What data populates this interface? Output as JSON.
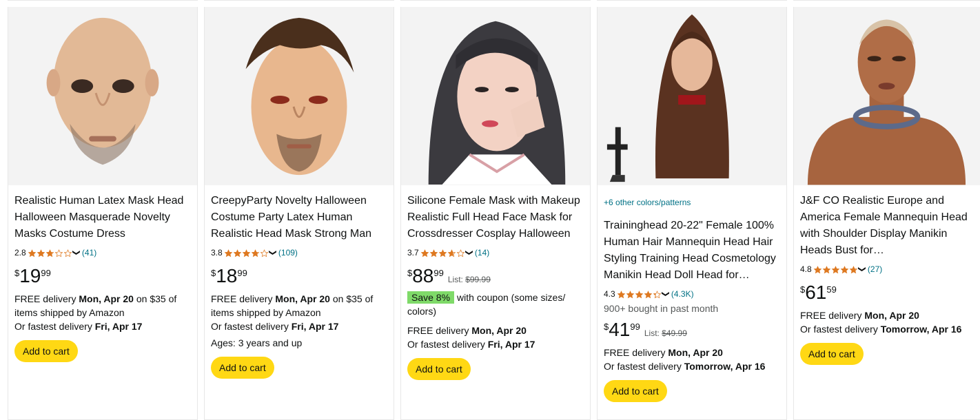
{
  "products": [
    {
      "title_lines": [
        "Realistic Human Latex Mask Head",
        "Halloween Masquerade Novelty",
        "Masks Costume Dress"
      ],
      "rating": "2.8",
      "stars_filled": 2.8,
      "reviews": "(41)",
      "price_symbol": "$",
      "price_whole": "19",
      "price_fraction": "99",
      "delivery_1_pre": "FREE delivery ",
      "delivery_1_date": "Mon, Apr 20",
      "delivery_1_post": " on $35 of",
      "delivery_2": "items shipped by Amazon",
      "fastest_pre": "Or fastest delivery ",
      "fastest_date": "Fri, Apr 17",
      "button": "Add to cart"
    },
    {
      "title_lines": [
        "CreepyParty Novelty Halloween",
        "Costume Party Latex Human",
        "Realistic Head Mask Strong Man"
      ],
      "rating": "3.8",
      "stars_filled": 3.8,
      "reviews": "(109)",
      "price_symbol": "$",
      "price_whole": "18",
      "price_fraction": "99",
      "delivery_1_pre": "FREE delivery ",
      "delivery_1_date": "Mon, Apr 20",
      "delivery_1_post": " on $35 of",
      "delivery_2": "items shipped by Amazon",
      "fastest_pre": "Or fastest delivery ",
      "fastest_date": "Fri, Apr 17",
      "ages": "Ages: 3 years and up",
      "button": "Add to cart"
    },
    {
      "title_lines": [
        "Silicone Female Mask with Makeup",
        "Realistic Full Head Face Mask for",
        "Crossdresser Cosplay Halloween"
      ],
      "rating": "3.7",
      "stars_filled": 3.7,
      "reviews": "(14)",
      "price_symbol": "$",
      "price_whole": "88",
      "price_fraction": "99",
      "list_label": "List: ",
      "list_price": "$99.99",
      "coupon_badge": "Save 8%",
      "coupon_text": "with coupon (some sizes/",
      "coupon_text_2": "colors)",
      "delivery_1_pre": "FREE delivery ",
      "delivery_1_date": "Mon, Apr 20",
      "fastest_pre": "Or fastest delivery ",
      "fastest_date": "Fri, Apr 17",
      "button": "Add to cart"
    },
    {
      "colors_link": "+6 other colors/patterns",
      "title_lines": [
        "Traininghead 20-22\" Female 100%",
        "Human Hair Mannequin Head Hair",
        "Styling Training Head Cosmetology",
        "Manikin Head Doll Head for…"
      ],
      "rating": "4.3",
      "stars_filled": 4.3,
      "reviews": "(4.3K)",
      "bought": "900+ bought in past month",
      "price_symbol": "$",
      "price_whole": "41",
      "price_fraction": "99",
      "list_label": "List: ",
      "list_price": "$49.99",
      "delivery_1_pre": "FREE delivery ",
      "delivery_1_date": "Mon, Apr 20",
      "fastest_pre": "Or fastest delivery ",
      "fastest_date": "Tomorrow, Apr 16",
      "button": "Add to cart"
    },
    {
      "title_lines": [
        "J&F CO Realistic Europe and",
        "America Female Mannequin Head",
        "with Shoulder Display Manikin",
        "Heads Bust for…"
      ],
      "rating": "4.8",
      "stars_filled": 4.8,
      "reviews": "(27)",
      "price_symbol": "$",
      "price_whole": "61",
      "price_fraction": "59",
      "delivery_1_pre": "FREE delivery ",
      "delivery_1_date": "Mon, Apr 20",
      "fastest_pre": "Or fastest delivery ",
      "fastest_date": "Tomorrow, Apr 16",
      "button": "Add to cart"
    }
  ],
  "colors": {
    "star": "#de7921",
    "link": "#007185",
    "button": "#ffd814",
    "coupon": "#7fda69"
  },
  "icons": {
    "rating_dropdown": "chevron-down-icon",
    "star": "star-icon"
  }
}
